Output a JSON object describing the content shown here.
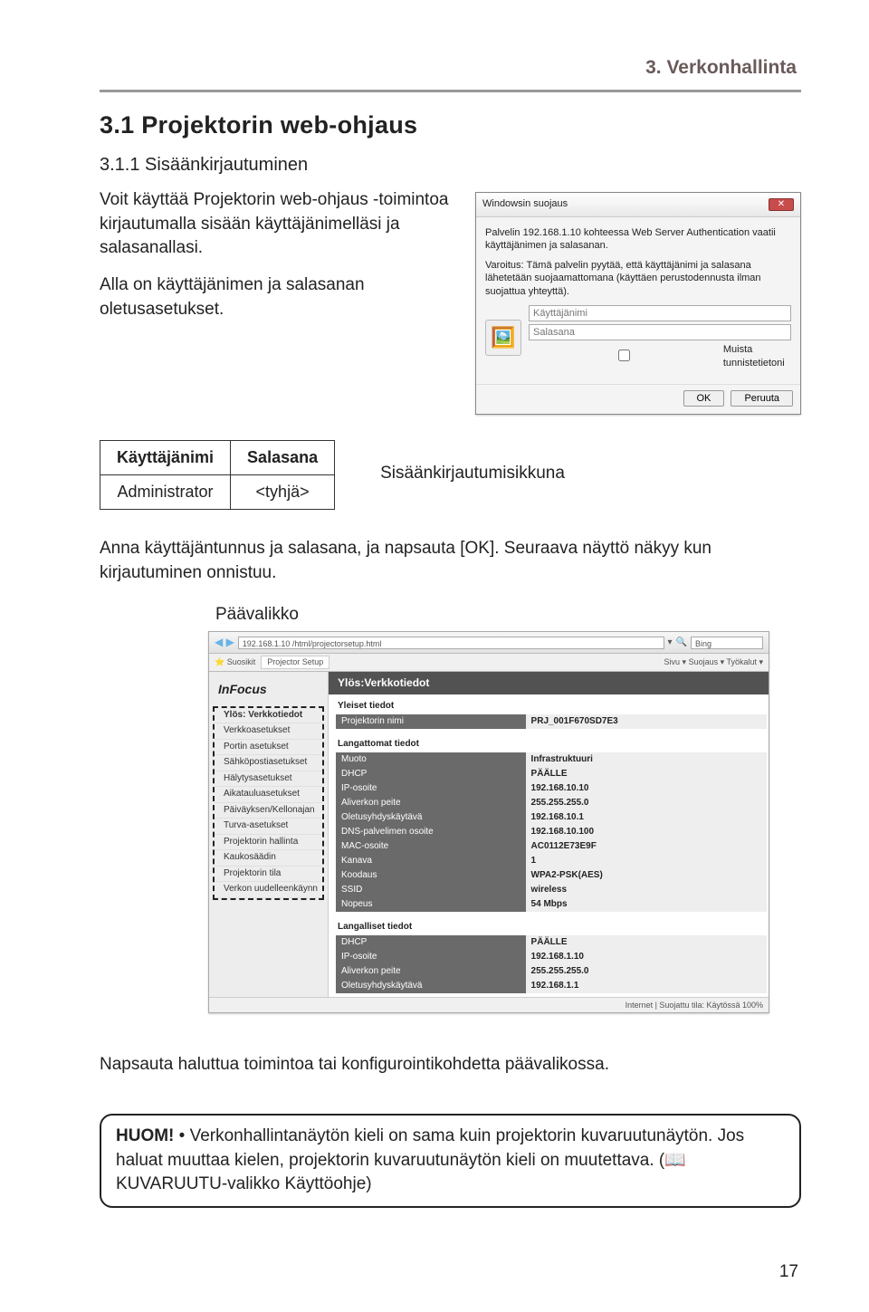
{
  "header": {
    "section_title": "3. Verkonhallinta"
  },
  "h1": "3.1 Projektorin web-ohjaus",
  "h2": "3.1.1 Sisäänkirjautuminen",
  "intro": {
    "p1": "Voit käyttää Projektorin web-ohjaus -toimintoa kirjautumalla sisään käyttäjänimelläsi ja salasanallasi.",
    "p2": "Alla on käyttäjänimen ja salasanan oletusasetukset."
  },
  "dialog": {
    "title": "Windowsin suojaus",
    "line1": "Palvelin 192.168.1.10 kohteessa Web Server Authentication vaatii käyttäjänimen ja salasanan.",
    "line2": "Varoitus: Tämä palvelin pyytää, että käyttäjänimi ja salasana lähetetään suojaamattomana (käyttäen perustodennusta ilman suojattua yhteyttä).",
    "user_ph": "Käyttäjänimi",
    "pass_ph": "Salasana",
    "remember": "Muista tunnistetietoni",
    "ok": "OK",
    "cancel": "Peruuta"
  },
  "cred_table": {
    "h_user": "Käyttäjänimi",
    "h_pass": "Salasana",
    "r_user": "Administrator",
    "r_pass": "<tyhjä>"
  },
  "sisaan_label": "Sisäänkirjautumisikkuna",
  "para_after": "Anna käyttäjäntunnus ja salasana, ja napsauta [OK]. Seuraava näyttö näkyy kun kirjautuminen onnistuu.",
  "paavalikko": "Päävalikko",
  "browser": {
    "address": "192.168.1.10 /html/projectorsetup.html",
    "search": "Bing",
    "fav": "Suosikit",
    "tab": "Projector Setup",
    "right": "Sivu ▾  Suojaus ▾  Työkalut ▾",
    "logo": "InFocus",
    "banner": "Ylös:Verkkotiedot",
    "status": "Internet | Suojattu tila: Käytössä        100%"
  },
  "sidebar": [
    "Ylös: Verkkotiedot",
    "Verkkoasetukset",
    "Portin asetukset",
    "Sähköpostiasetukset",
    "Hälytysasetukset",
    "Aikatauluasetukset",
    "Päiväyksen/Kellonajan",
    "Turva-asetukset",
    "Projektorin hallinta",
    "Kaukosäädin",
    "Projektorin tila",
    "Verkon uudelleenkäynn"
  ],
  "sections": {
    "yleiset": "Yleiset tiedot",
    "langattomat": "Langattomat tiedot",
    "langalliset": "Langalliset tiedot"
  },
  "kv_yleiset": [
    [
      "Projektorin nimi",
      "PRJ_001F670SD7E3"
    ]
  ],
  "kv_langattomat": [
    [
      "Muoto",
      "Infrastruktuuri"
    ],
    [
      "DHCP",
      "PÄÄLLE"
    ],
    [
      "IP-osoite",
      "192.168.10.10"
    ],
    [
      "Aliverkon peite",
      "255.255.255.0"
    ],
    [
      "Oletusyhdyskäytävä",
      "192.168.10.1"
    ],
    [
      "DNS-palvelimen osoite",
      "192.168.10.100"
    ],
    [
      "MAC-osoite",
      "AC0112E73E9F"
    ],
    [
      "Kanava",
      "1"
    ],
    [
      "Koodaus",
      "WPA2-PSK(AES)"
    ],
    [
      "SSID",
      "wireless"
    ],
    [
      "Nopeus",
      "54 Mbps"
    ]
  ],
  "kv_langalliset": [
    [
      "DHCP",
      "PÄÄLLE"
    ],
    [
      "IP-osoite",
      "192.168.1.10"
    ],
    [
      "Aliverkon peite",
      "255.255.255.0"
    ],
    [
      "Oletusyhdyskäytävä",
      "192.168.1.1"
    ]
  ],
  "bottom_para": "Napsauta haluttua toimintoa tai konfigurointikohdetta päävalikossa.",
  "huom": {
    "label": "HUOM!",
    "l1": " • Verkonhallintanäytön kieli on sama kuin projektorin kuvaruutunäytön. Jos haluat muuttaa kielen, projektorin kuvaruutunäytön kieli on muutettava. (",
    "l2": "KUVARUUTU-valikko Käyttöohje)",
    "book": "📖"
  },
  "page_num": "17"
}
